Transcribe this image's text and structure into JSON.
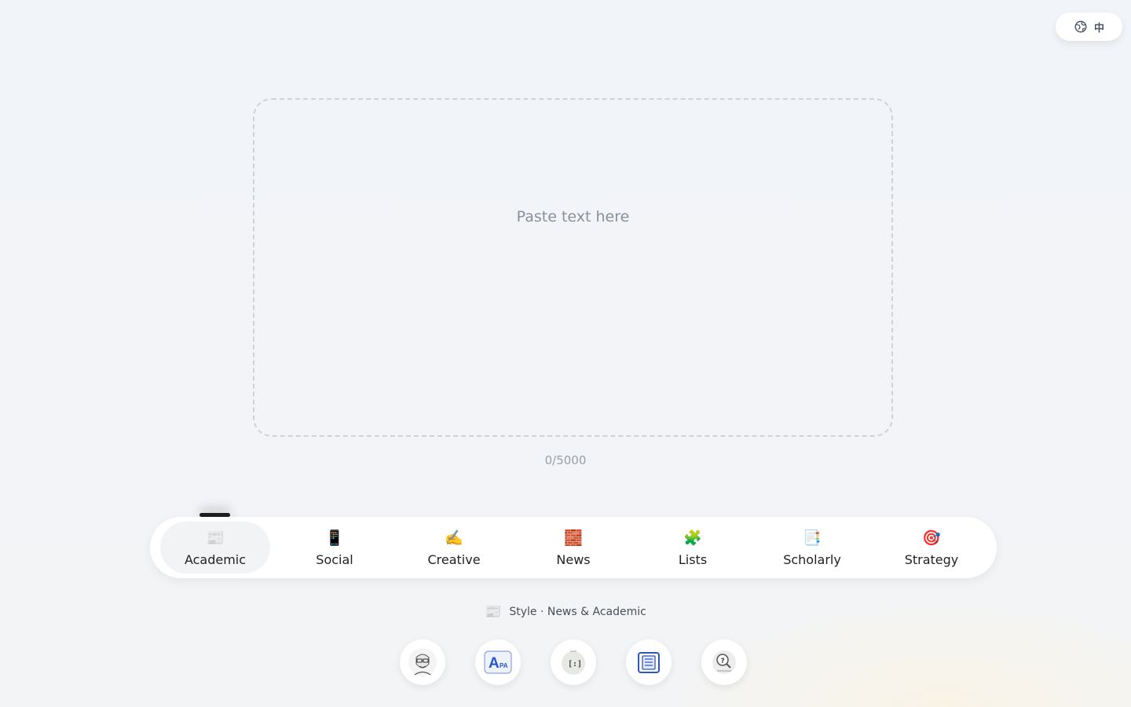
{
  "language_toggle": {
    "label": "中",
    "icon": "globe-icon"
  },
  "editor": {
    "placeholder": "Paste text here",
    "char_count": "0/5000"
  },
  "tabs": [
    {
      "label": "Academic",
      "icon": "📰",
      "active": true
    },
    {
      "label": "Social",
      "icon": "📱",
      "active": false
    },
    {
      "label": "Creative",
      "icon": "✍️",
      "active": false
    },
    {
      "label": "News",
      "icon": "🧱",
      "active": false
    },
    {
      "label": "Lists",
      "icon": "🧩",
      "active": false
    },
    {
      "label": "Scholarly",
      "icon": "📑",
      "active": false
    },
    {
      "label": "Strategy",
      "icon": "🎯",
      "active": false
    }
  ],
  "style_caption": {
    "icon": "📰",
    "text": "Style · News & Academic"
  },
  "presets": [
    {
      "icon": "portrait-sketch-icon"
    },
    {
      "icon": "apa-icon"
    },
    {
      "icon": "bracket-icon"
    },
    {
      "icon": "document-icon"
    },
    {
      "icon": "magnifier-question-icon"
    }
  ],
  "colors": {
    "background": "#f1f4f8",
    "dashed_border": "#cfd3d8",
    "active_indicator": "#1e1e1e",
    "apa_blue": "#2a55c9"
  }
}
